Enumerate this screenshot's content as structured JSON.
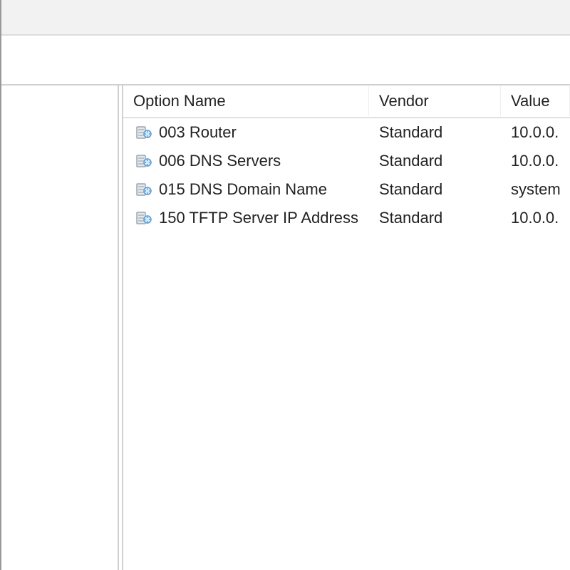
{
  "columns": {
    "option_name": "Option Name",
    "vendor": "Vendor",
    "value": "Value"
  },
  "rows": [
    {
      "name": "003 Router",
      "vendor": "Standard",
      "value": "10.0.0."
    },
    {
      "name": "006 DNS Servers",
      "vendor": "Standard",
      "value": "10.0.0."
    },
    {
      "name": "015 DNS Domain Name",
      "vendor": "Standard",
      "value": "system"
    },
    {
      "name": "150 TFTP Server IP Address",
      "vendor": "Standard",
      "value": "10.0.0."
    }
  ]
}
